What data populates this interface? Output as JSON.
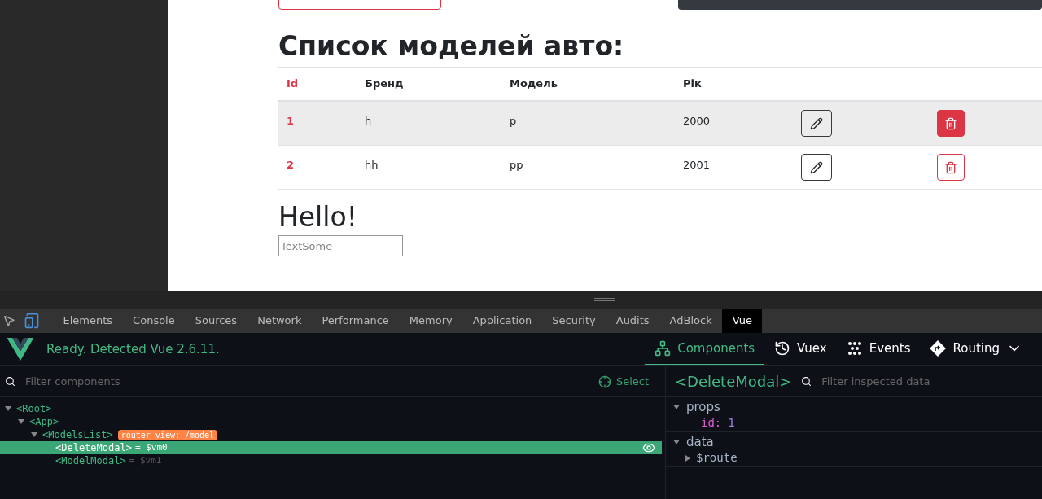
{
  "page": {
    "heading": "Список моделей авто:",
    "table": {
      "columns": [
        "Id",
        "Бренд",
        "Модель",
        "Рік"
      ],
      "rows": [
        {
          "id": "1",
          "brand": "h",
          "model": "p",
          "year": "2000",
          "highlighted": true
        },
        {
          "id": "2",
          "brand": "hh",
          "model": "pp",
          "year": "2001",
          "highlighted": false
        }
      ]
    },
    "subheading": "Hello!",
    "input": {
      "placeholder": "TextSome"
    }
  },
  "devtools": {
    "tabs": [
      {
        "label": "Elements",
        "selected": false
      },
      {
        "label": "Console",
        "selected": false
      },
      {
        "label": "Sources",
        "selected": false
      },
      {
        "label": "Network",
        "selected": false
      },
      {
        "label": "Performance",
        "selected": false
      },
      {
        "label": "Memory",
        "selected": false
      },
      {
        "label": "Application",
        "selected": false
      },
      {
        "label": "Security",
        "selected": false
      },
      {
        "label": "Audits",
        "selected": false
      },
      {
        "label": "AdBlock",
        "selected": false
      },
      {
        "label": "Vue",
        "selected": true
      }
    ],
    "status": "Ready. Detected Vue 2.6.11.",
    "nav": [
      {
        "kind": "components",
        "label": "Components",
        "selected": true
      },
      {
        "kind": "vuex",
        "label": "Vuex",
        "selected": false
      },
      {
        "kind": "events",
        "label": "Events",
        "selected": false
      },
      {
        "kind": "routing",
        "label": "Routing",
        "selected": false
      }
    ],
    "filter": {
      "placeholder": "Filter components"
    },
    "select": "Select",
    "tree": [
      {
        "name": "<Root>",
        "expanded": true,
        "children": [
          {
            "name": "<App>",
            "expanded": true,
            "children": [
              {
                "name": "<ModelsList>",
                "expanded": true,
                "badge": "router-view: /model",
                "children": [
                  {
                    "name": "<DeleteModal>",
                    "ref": "= $vm0",
                    "selected": true
                  },
                  {
                    "name": "<ModelModal>",
                    "ref": "= $vm1",
                    "selected": false
                  }
                ]
              }
            ]
          }
        ]
      }
    ],
    "inspector": {
      "component": "<DeleteModal>",
      "filter_placeholder": "Filter inspected data",
      "sections": [
        {
          "title": "props",
          "expanded": true,
          "entries": [
            {
              "key": "id:",
              "value": "1",
              "expandable": false
            }
          ]
        },
        {
          "title": "data",
          "expanded": true,
          "entries": [
            {
              "key": "$route",
              "expandable": true
            }
          ]
        }
      ]
    }
  }
}
